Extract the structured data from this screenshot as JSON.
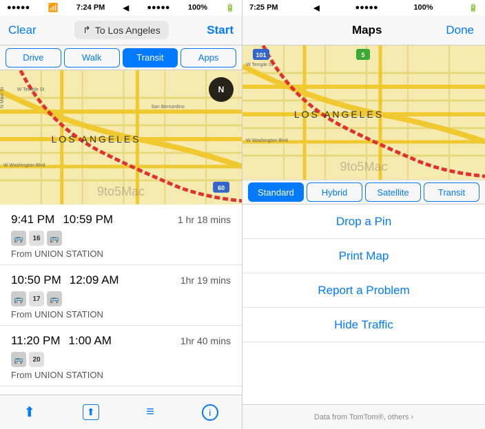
{
  "left": {
    "status_bar": {
      "dots": "●●●●●",
      "wifi": "wifi",
      "time": "7:24 PM",
      "location": "▲",
      "signal": "●●●●●",
      "battery": "100%"
    },
    "nav": {
      "clear_label": "Clear",
      "destination": "To Los Angeles",
      "start_label": "Start"
    },
    "transport_tabs": [
      {
        "label": "Drive",
        "active": false
      },
      {
        "label": "Walk",
        "active": false
      },
      {
        "label": "Transit",
        "active": true
      },
      {
        "label": "Apps",
        "active": false
      }
    ],
    "routes": [
      {
        "depart": "9:41 PM",
        "arrive": "10:59 PM",
        "duration": "1 hr 18 mins",
        "icons": [
          "bus",
          "16",
          "bus"
        ],
        "from": "From UNION STATION"
      },
      {
        "depart": "10:50 PM",
        "arrive": "12:09 AM",
        "duration": "1hr 19 mins",
        "icons": [
          "bus",
          "17",
          "bus"
        ],
        "from": "From UNION STATION"
      },
      {
        "depart": "11:20 PM",
        "arrive": "1:00 AM",
        "duration": "1hr 40 mins",
        "icons": [
          "bus",
          "20"
        ],
        "from": "From UNION STATION"
      }
    ],
    "toolbar": {
      "location": "⬆",
      "share": "⬆",
      "list": "≡",
      "info": "ℹ"
    }
  },
  "right": {
    "status_bar": {
      "time": "7:25 PM",
      "location": "▲",
      "signal": "●●●●●",
      "battery": "100%"
    },
    "nav": {
      "title": "Maps",
      "done_label": "Done"
    },
    "map_type_tabs": [
      {
        "label": "Standard",
        "active": true
      },
      {
        "label": "Hybrid",
        "active": false
      },
      {
        "label": "Satellite",
        "active": false
      },
      {
        "label": "Transit",
        "active": false
      }
    ],
    "menu_items": [
      {
        "label": "Drop a Pin"
      },
      {
        "label": "Print Map"
      },
      {
        "label": "Report a Problem"
      },
      {
        "label": "Hide Traffic"
      }
    ],
    "footer": {
      "text": "Data from TomTom®, others ›"
    }
  }
}
